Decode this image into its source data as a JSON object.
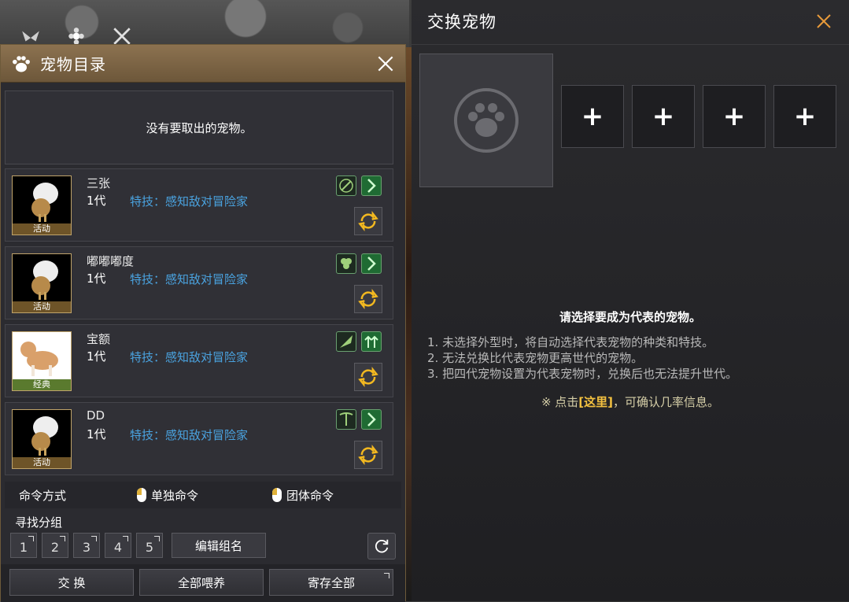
{
  "pet_panel": {
    "title": "宠物目录",
    "empty_message": "没有要取出的宠物。",
    "pets": [
      {
        "name": "三张",
        "generation": "1代",
        "skill": "特技：感知敌对冒险家",
        "status": "活动"
      },
      {
        "name": "嘟嘟嘟度",
        "generation": "1代",
        "skill": "特技：感知敌对冒险家",
        "status": "活动"
      },
      {
        "name": "宝额",
        "generation": "1代",
        "skill": "特技：感知敌对冒险家",
        "status": "经典"
      },
      {
        "name": "DD",
        "generation": "1代",
        "skill": "特技：感知敌对冒险家",
        "status": "活动"
      }
    ],
    "command": {
      "label": "命令方式",
      "single": "单独命令",
      "group": "团体命令"
    },
    "group": {
      "label": "寻找分组",
      "buttons": [
        "1",
        "2",
        "3",
        "4",
        "5"
      ],
      "edit_label": "编辑组名"
    },
    "bottom": {
      "exchange": "交 换",
      "feed_all": "全部喂养",
      "store_all": "寄存全部"
    }
  },
  "exchange_panel": {
    "title": "交换宠物",
    "add_symbol": "+",
    "info": "请选择要成为代表的宠物。",
    "notes": [
      "1. 未选择外型时，将自动选择代表宠物的种类和特技。",
      "2. 无法兑换比代表宠物更高世代的宠物。",
      "3. 把四代宠物设置为代表宠物时，兑换后也无法提升世代。"
    ],
    "link_prefix": "※ 点击",
    "link_text": "[这里]",
    "link_suffix": "，可确认几率信息。"
  },
  "colors": {
    "skill_text": "#4aa3e0",
    "header_gold": "#8c7250",
    "link_highlight": "#f2c040"
  }
}
